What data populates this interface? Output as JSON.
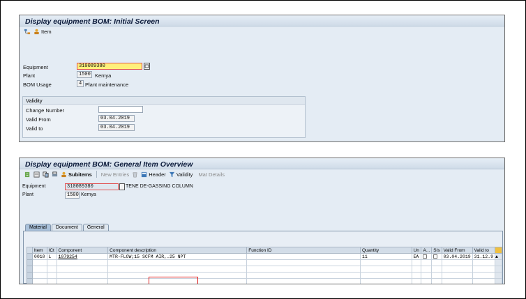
{
  "screen1": {
    "title": "Display equipment BOM: Initial Screen",
    "toolbar": {
      "item_label": "Item"
    },
    "fields": {
      "equipment_label": "Equipment",
      "equipment_value": "310089380",
      "plant_label": "Plant",
      "plant_value": "1500",
      "plant_text": "Kemya",
      "bom_usage_label": "BOM Usage",
      "bom_usage_value": "4",
      "bom_usage_text": "Plant maintenance"
    },
    "validity": {
      "title": "Validity",
      "change_number_label": "Change Number",
      "change_number_value": "",
      "valid_from_label": "Valid From",
      "valid_from_value": "03.04.2019",
      "valid_to_label": "Valid to",
      "valid_to_value": "03.04.2019"
    }
  },
  "screen2": {
    "title": "Display equipment BOM: General Item Overview",
    "toolbar": {
      "subitems_label": "Subitems",
      "new_entries_label": "New Entries",
      "header_label": "Header",
      "validity_label": "Validity",
      "mat_details_label": "Mat Details"
    },
    "fields": {
      "equipment_label": "Equipment",
      "equipment_value": "310089380",
      "equipment_text": "TENE DE-GASSING COLUMN",
      "plant_label": "Plant",
      "plant_value": "1500",
      "plant_text": "Kemya"
    },
    "tabs": [
      "Material",
      "Document",
      "General"
    ],
    "table": {
      "columns": [
        "Item",
        "ICt",
        "Component",
        "Component description",
        "Function ID",
        "Quantity",
        "Un",
        "A...",
        "SIs",
        "Valid From",
        "Valid to"
      ],
      "rows": [
        [
          "0010",
          "L",
          "1079254",
          "MTR-FLOW;15 SCFM AIR,.25 NPT",
          "",
          "11",
          "EA",
          "",
          "",
          "03.04.2019",
          "31.12.9"
        ]
      ]
    }
  },
  "colors": {
    "panel_bg": "#e4ecf4",
    "focus_field": "#fff07a",
    "title_text": "#0b1a3a",
    "highlight_border": "#e02020"
  }
}
